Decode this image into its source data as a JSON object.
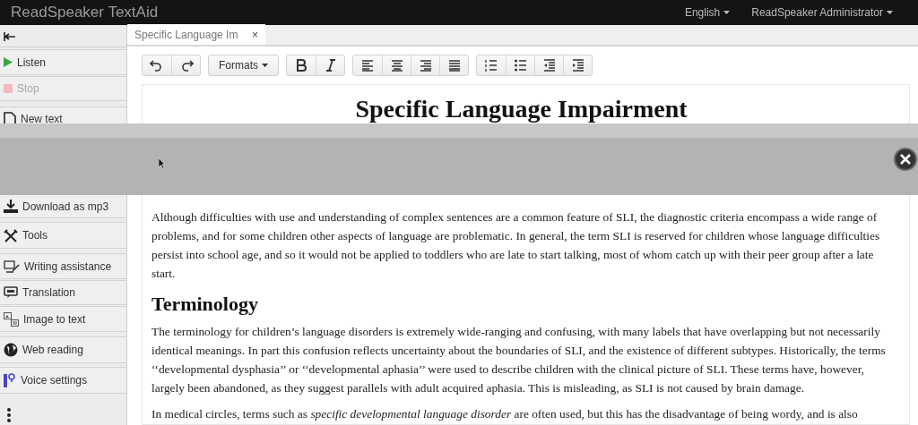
{
  "app_title": "ReadSpeaker TextAid",
  "top_menu": [
    {
      "label": "English"
    },
    {
      "label": "ReadSpeaker Administrator"
    }
  ],
  "sidebar": {
    "items": [
      {
        "kind": "collapse"
      },
      {
        "kind": "listen",
        "label": "Listen",
        "disabled": false
      },
      {
        "kind": "stop",
        "label": "Stop",
        "disabled": true
      },
      {
        "kind": "new",
        "label": "New text",
        "disabled": false
      },
      {
        "kind": "download",
        "label": "Download as mp3",
        "disabled": false
      },
      {
        "kind": "tools",
        "label": "Tools",
        "disabled": false
      },
      {
        "kind": "writing",
        "label": "Writing assistance",
        "disabled": false
      },
      {
        "kind": "translation",
        "label": "Translation",
        "disabled": false
      },
      {
        "kind": "image",
        "label": "Image to text",
        "disabled": false
      },
      {
        "kind": "web",
        "label": "Web reading",
        "disabled": false
      },
      {
        "kind": "voice",
        "label": "Voice settings",
        "disabled": false
      },
      {
        "kind": "more"
      }
    ]
  },
  "tabs": [
    {
      "label": "Specific Language Im",
      "selected": true,
      "close": "×"
    }
  ],
  "toolbar": [
    {
      "group": [
        {
          "kind": "undo"
        },
        {
          "kind": "redo"
        }
      ]
    },
    {
      "group": [
        {
          "kind": "formats",
          "label": "Formats"
        }
      ]
    },
    {
      "group": [
        {
          "kind": "bold"
        },
        {
          "kind": "italic"
        }
      ]
    },
    {
      "group": [
        {
          "kind": "align-left"
        },
        {
          "kind": "align-center"
        },
        {
          "kind": "align-right"
        },
        {
          "kind": "justify"
        }
      ]
    },
    {
      "group": [
        {
          "kind": "numbered-list"
        },
        {
          "kind": "bullet-list"
        },
        {
          "kind": "outdent"
        },
        {
          "kind": "indent"
        }
      ]
    }
  ],
  "document": [
    {
      "kind": "title",
      "text": "Specific Language Impairment"
    },
    {
      "kind": "paragraph",
      "text": "Although difficulties with use and understanding of complex sentences are a common feature of SLI, the diagnostic criteria encompass a wide range of problems, and for some children other aspects of language are problematic. In general, the term SLI is reserved for children whose language difficulties persist into school age, and so it would not be applied to toddlers who are late to start talking, most of whom catch up with their peer group after a late start."
    },
    {
      "kind": "heading",
      "text": "Terminology"
    },
    {
      "kind": "paragraph",
      "text": "The terminology for children’s language disorders is extremely wide-ranging and confusing, with many labels that have overlapping but not necessarily identical meanings. In part this confusion reflects uncertainty about the boundaries of SLI, and the existence of different subtypes. Historically, the terms ‘‘developmental dysphasia’’ or ‘‘developmental aphasia’’ were used to describe children with the clinical picture of SLI. These terms have, however, largely been abandoned, as they suggest parallels with adult acquired aphasia. This is misleading, as SLI is not caused by brain damage."
    },
    {
      "kind": "paragraph",
      "text": "In medical circles, terms such as *specific developmental language disorder* are often used, but this has the disadvantage of being wordy, and is also"
    }
  ],
  "overlay": {
    "close": true
  }
}
